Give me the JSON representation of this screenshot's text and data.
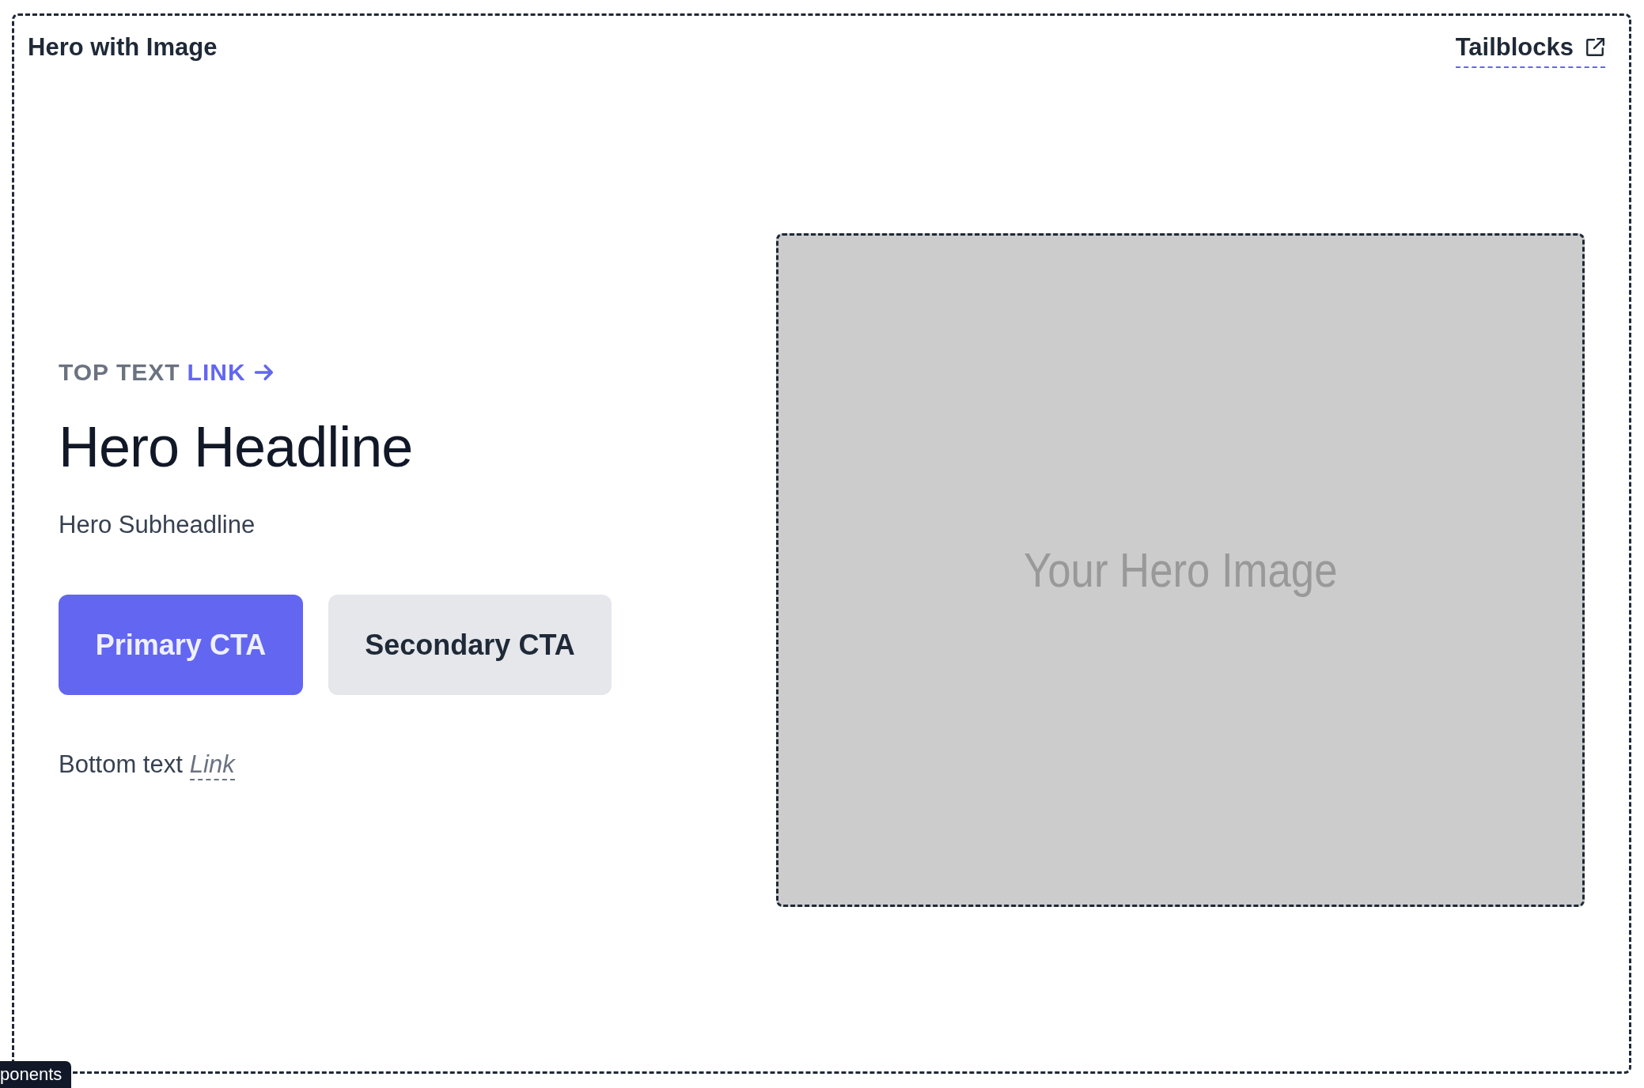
{
  "header": {
    "title": "Hero with Image",
    "link": {
      "label": "Tailblocks"
    }
  },
  "hero": {
    "top_text": "TOP TEXT",
    "top_link": "LINK",
    "headline": "Hero Headline",
    "subheadline": "Hero Subheadline",
    "buttons": [
      {
        "label": "Primary CTA",
        "kind": "primary"
      },
      {
        "label": "Secondary CTA",
        "kind": "secondary"
      }
    ],
    "bottom_text": "Bottom text",
    "bottom_link": "Link"
  },
  "image": {
    "placeholder_text": "Your Hero Image"
  },
  "tooltip": {
    "text": "ponents"
  }
}
